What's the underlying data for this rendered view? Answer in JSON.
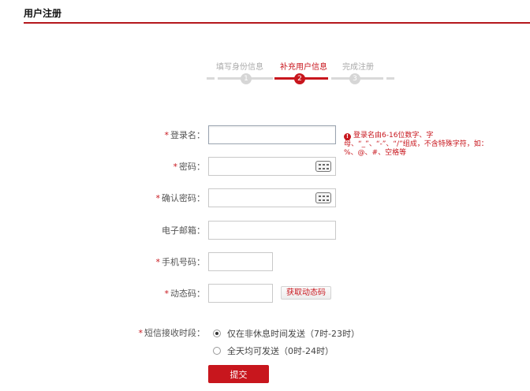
{
  "header": {
    "title": "用户注册"
  },
  "steps": [
    {
      "label": "填写身份信息",
      "number": "1",
      "active": false
    },
    {
      "label": "补充用户信息",
      "number": "2",
      "active": true
    },
    {
      "label": "完成注册",
      "number": "3",
      "active": false
    }
  ],
  "form": {
    "username": {
      "label": "登录名：",
      "value": "",
      "placeholder": ""
    },
    "username_hint": "登录名由6-16位数字、字母、“_”、“-”、“/”组成，不含特殊字符，如：%、@、#、空格等",
    "password": {
      "label": "密码：",
      "value": ""
    },
    "confirm_password": {
      "label": "确认密码：",
      "value": ""
    },
    "email": {
      "label": "电子邮箱：",
      "value": ""
    },
    "phone": {
      "label": "手机号码：",
      "value": ""
    },
    "dynamic_code": {
      "label": "动态码：",
      "value": "",
      "button": "获取动态码"
    },
    "sms_time": {
      "label": "短信接收时段：",
      "options": [
        {
          "label": "仅在非休息时间发送（7时-23时）",
          "checked": true
        },
        {
          "label": "全天均可发送（0时-24时）",
          "checked": false
        }
      ]
    },
    "submit": "提交"
  },
  "colors": {
    "accent": "#c8161d"
  }
}
